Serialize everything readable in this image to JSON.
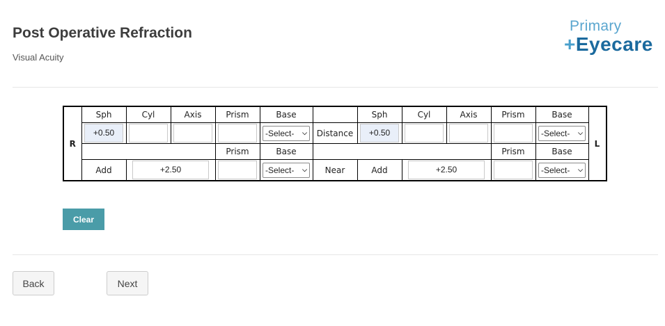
{
  "header": {
    "title": "Post Operative Refraction",
    "subtitle": "Visual Acuity"
  },
  "logo": {
    "line1": "Primary",
    "line2_cross": "+",
    "line2_text": "Eyecare"
  },
  "rx": {
    "right_label": "R",
    "left_label": "L",
    "headers": {
      "sph": "Sph",
      "cyl": "Cyl",
      "axis": "Axis",
      "prism": "Prism",
      "base": "Base"
    },
    "distance": {
      "label": "Distance",
      "right": {
        "sph": "+0.50",
        "cyl": "",
        "axis": "",
        "prism": "",
        "base": "-Select-"
      },
      "left": {
        "sph": "+0.50",
        "cyl": "",
        "axis": "",
        "prism": "",
        "base": "-Select-"
      }
    },
    "near": {
      "label": "Near",
      "add_label": "Add",
      "right": {
        "add": "+2.50",
        "prism": "",
        "base": "-Select-"
      },
      "left": {
        "add": "+2.50",
        "prism": "",
        "base": "-Select-"
      }
    }
  },
  "buttons": {
    "clear": "Clear",
    "back": "Back",
    "next": "Next"
  },
  "colors": {
    "clear_button": "#4a9ca8",
    "filled_input": "#e9eff9",
    "logo_dark": "#1b6a9e",
    "logo_light": "#5aa6cf"
  }
}
